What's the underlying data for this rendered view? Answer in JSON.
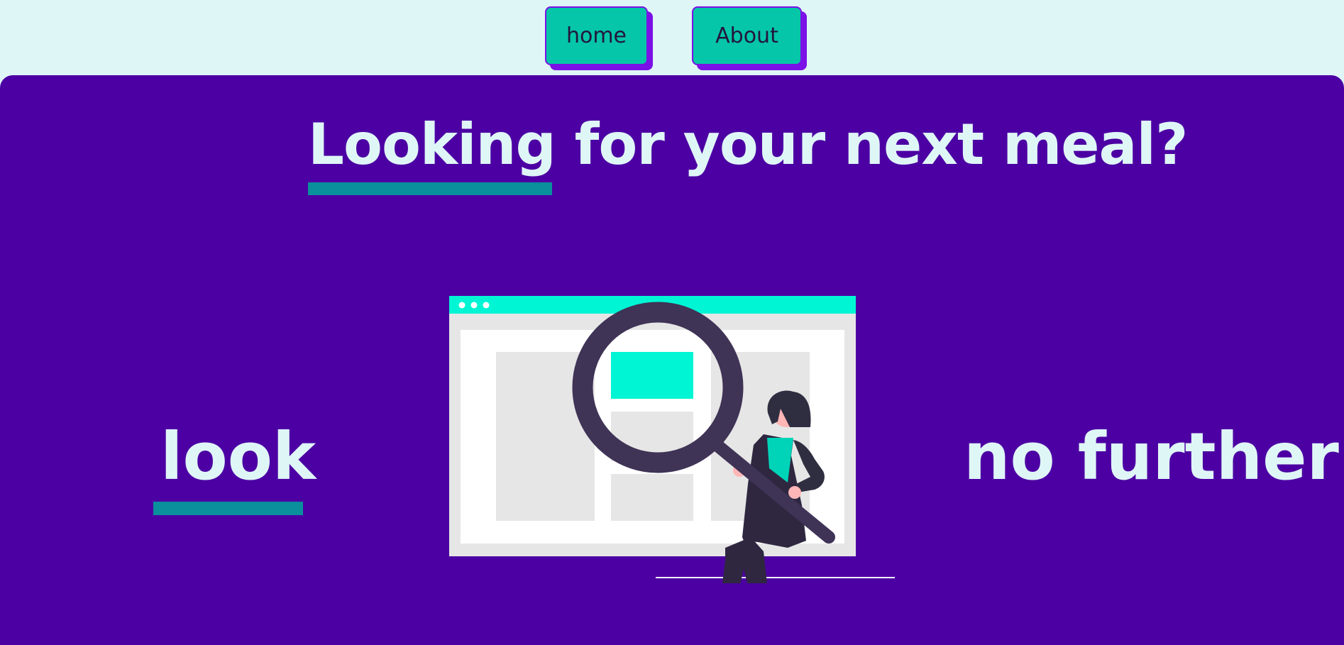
{
  "nav": {
    "home_label": "home",
    "about_label": "About"
  },
  "hero": {
    "headline": "Looking for your next meal?",
    "word_left": "look",
    "word_right": "no further"
  },
  "illustration": {
    "name": "person-with-magnifying-glass-illustration"
  },
  "colors": {
    "nav_background": "#dff6f7",
    "hero_background": "#4c00a3",
    "button_fill": "#05c6a8",
    "button_border": "#7b11e6",
    "accent_underline": "#0a8f9c",
    "text_light": "#dff6f7",
    "browser_bar": "#00f5d4"
  }
}
